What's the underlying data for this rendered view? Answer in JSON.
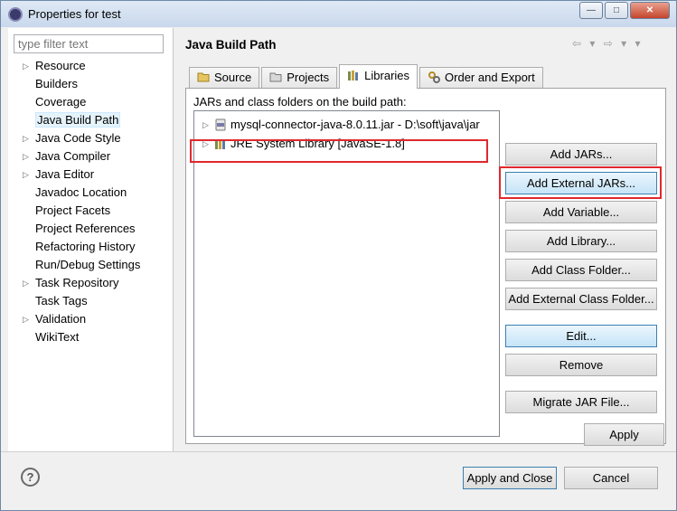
{
  "window": {
    "title": "Properties for test",
    "controls": [
      "—",
      "□",
      "✕"
    ]
  },
  "sidebar": {
    "filter_placeholder": "type filter text",
    "items": [
      {
        "label": "Resource",
        "expandable": true
      },
      {
        "label": "Builders",
        "expandable": false
      },
      {
        "label": "Coverage",
        "expandable": false
      },
      {
        "label": "Java Build Path",
        "expandable": false,
        "selected": true
      },
      {
        "label": "Java Code Style",
        "expandable": true
      },
      {
        "label": "Java Compiler",
        "expandable": true
      },
      {
        "label": "Java Editor",
        "expandable": true
      },
      {
        "label": "Javadoc Location",
        "expandable": false
      },
      {
        "label": "Project Facets",
        "expandable": false
      },
      {
        "label": "Project References",
        "expandable": false
      },
      {
        "label": "Refactoring History",
        "expandable": false
      },
      {
        "label": "Run/Debug Settings",
        "expandable": false
      },
      {
        "label": "Task Repository",
        "expandable": true
      },
      {
        "label": "Task Tags",
        "expandable": false
      },
      {
        "label": "Validation",
        "expandable": true
      },
      {
        "label": "WikiText",
        "expandable": false
      }
    ]
  },
  "main": {
    "title": "Java Build Path",
    "nav": "⇦ ▾ ⇨ ▾ ▾",
    "tabs": [
      {
        "label": "Source",
        "icon": "source-folder-icon"
      },
      {
        "label": "Projects",
        "icon": "projects-icon"
      },
      {
        "label": "Libraries",
        "icon": "libraries-icon",
        "active": true
      },
      {
        "label": "Order and Export",
        "icon": "order-export-icon"
      }
    ],
    "build_path_label": "JARs and class folders on the build path:",
    "entries": [
      {
        "label": "mysql-connector-java-8.0.11.jar - D:\\soft\\java\\jar",
        "icon": "jar-icon"
      },
      {
        "label": "JRE System Library [JavaSE-1.8]",
        "icon": "jre-library-icon"
      }
    ],
    "buttons": {
      "add_jars": "Add JARs...",
      "add_external_jars": "Add External JARs...",
      "add_variable": "Add Variable...",
      "add_library": "Add Library...",
      "add_class_folder": "Add Class Folder...",
      "add_external_class_folder": "Add External Class Folder...",
      "edit": "Edit...",
      "remove": "Remove",
      "migrate_jar": "Migrate JAR File..."
    },
    "apply": "Apply"
  },
  "footer": {
    "help": "?",
    "apply_and_close": "Apply and Close",
    "cancel": "Cancel"
  },
  "colors": {
    "highlight": "#e0282e",
    "selected_button": "#c5e4f8"
  }
}
